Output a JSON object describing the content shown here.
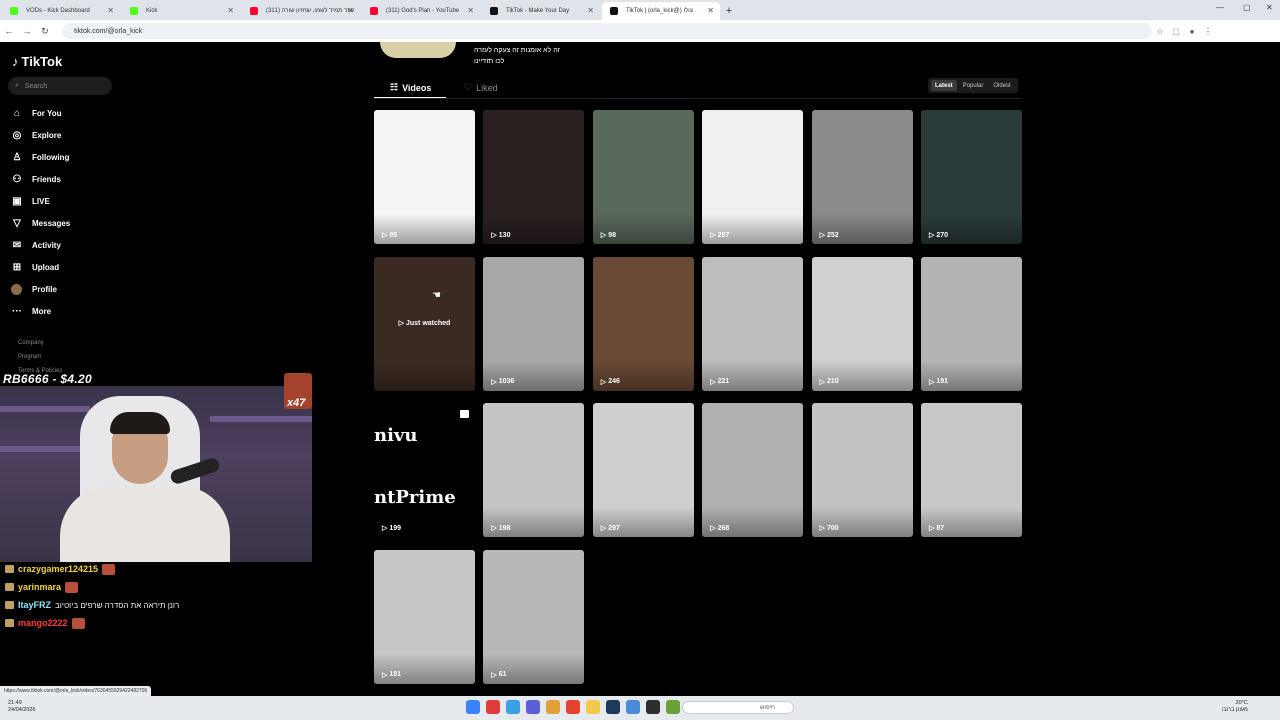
{
  "browser": {
    "tabs": [
      {
        "label": "VODs - Kick Dashboard",
        "color": "#53fc18"
      },
      {
        "label": "Kick",
        "color": "#53fc18"
      },
      {
        "label": "(311) עוזר תמיד לשמו, שחזיון שורה",
        "color": "#ff0033"
      },
      {
        "label": "(311) God's Plan - YouTube",
        "color": "#ff0033"
      },
      {
        "label": "TikTok - Make Your Day",
        "color": "#111111"
      },
      {
        "label": "TikTok | (orla_kick@) צולו",
        "color": "#111111"
      }
    ],
    "url": "tiktok.com/@orla_kick",
    "status_url": "https://www.tiktok.com/@orla_kick/video/7630455929422482706"
  },
  "sidebar": {
    "logo": "TikTok",
    "search_placeholder": "Search",
    "items": [
      {
        "label": "For You",
        "icon": "home-icon"
      },
      {
        "label": "Explore",
        "icon": "compass-icon"
      },
      {
        "label": "Following",
        "icon": "following-icon"
      },
      {
        "label": "Friends",
        "icon": "friends-icon"
      },
      {
        "label": "LIVE",
        "icon": "live-icon"
      },
      {
        "label": "Messages",
        "icon": "messages-icon"
      },
      {
        "label": "Activity",
        "icon": "activity-icon"
      },
      {
        "label": "Upload",
        "icon": "upload-icon"
      },
      {
        "label": "Profile",
        "icon": "avatar"
      },
      {
        "label": "More",
        "icon": "more-icon"
      }
    ],
    "footer_links": [
      "Company",
      "Program",
      "Terms & Policies"
    ]
  },
  "overlay": {
    "title": "RB6666 - $4.20",
    "gift_count": "x47",
    "chat": [
      {
        "user": "crazygamer124215",
        "color": "#f5d142",
        "msg": ""
      },
      {
        "user": "yarinmara",
        "color": "#f5d142",
        "msg": ""
      },
      {
        "user": "ItayFRZ",
        "color": "#8fe3ff",
        "msg": "רונן תיראה את הסדרה שרפים ביוטיוב"
      },
      {
        "user": "mango2222",
        "color": "#ff3b3b",
        "msg": ""
      }
    ]
  },
  "profile": {
    "bio_line1": "זה לא אומנות זה צעקה לעזרה",
    "bio_line2": "לכו תזדיינו",
    "tabs": {
      "videos": "Videos",
      "liked": "Liked"
    },
    "sort": [
      "Latest",
      "Popular",
      "Oldest"
    ],
    "sort_active": "Latest",
    "videos": [
      {
        "views": "95",
        "bg": "#f4f4f4"
      },
      {
        "views": "130",
        "bg": "#2a2020"
      },
      {
        "views": "98",
        "bg": "#5a6a5a"
      },
      {
        "views": "297",
        "bg": "#f0f0f0"
      },
      {
        "views": "252",
        "bg": "#8a8a8a"
      },
      {
        "views": "270",
        "bg": "#2a3a3a"
      },
      {
        "views": "",
        "bg": "#3a2a22",
        "watched": "Just watched"
      },
      {
        "views": "1036",
        "bg": "#a8a8a8"
      },
      {
        "views": "246",
        "bg": "#6a4a34"
      },
      {
        "views": "221",
        "bg": "#bdbdbd"
      },
      {
        "views": "210",
        "bg": "#d0d0d0"
      },
      {
        "views": "191",
        "bg": "#b4b4b4"
      },
      {
        "views": "199",
        "bg": "#000000",
        "text1": "nivu",
        "text2": "ntPrime"
      },
      {
        "views": "198",
        "bg": "#c4c4c4"
      },
      {
        "views": "297",
        "bg": "#cfcfcf"
      },
      {
        "views": "268",
        "bg": "#b0b0b0"
      },
      {
        "views": "700",
        "bg": "#c2c2c2"
      },
      {
        "views": "87",
        "bg": "#c8c8c8"
      },
      {
        "views": "181",
        "bg": "#c6c6c6"
      },
      {
        "views": "61",
        "bg": "#b8b8b8"
      }
    ]
  },
  "taskbar": {
    "time": "21:49",
    "date": "24/04/2026",
    "search_placeholder": "חיפוש",
    "weather_temp": "20°C",
    "weather_desc": "מעונן ברובו"
  }
}
